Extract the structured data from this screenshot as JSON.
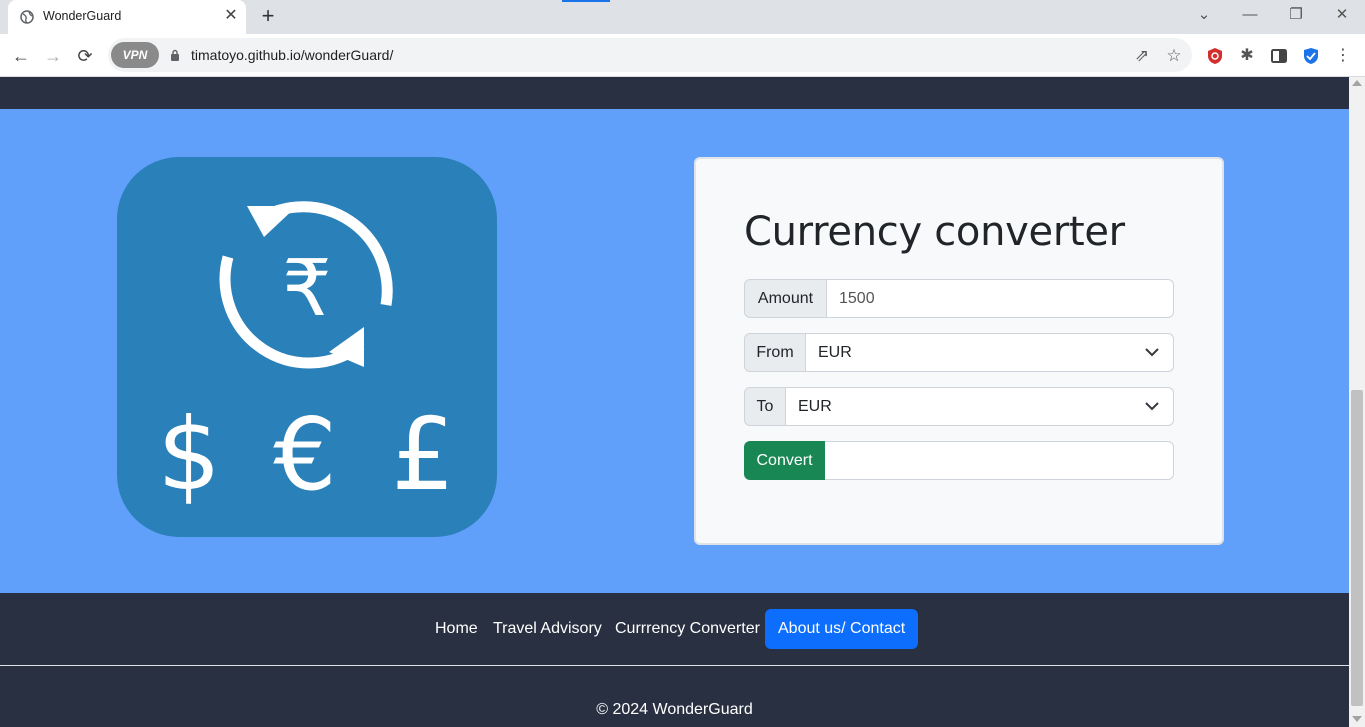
{
  "browser": {
    "tab_title": "WonderGuard",
    "tab_close_glyph": "✕",
    "new_tab_glyph": "+",
    "url": "timatoyo.github.io/wonderGuard/",
    "vpn_label": "VPN",
    "window_controls": {
      "collapse": "⌄",
      "minimize": "—",
      "restore": "❐",
      "close": "✕"
    },
    "nav": {
      "back": "←",
      "forward": "→",
      "reload": "⟳"
    },
    "omni_icons": {
      "share": "⇗",
      "bookmark": "☆"
    },
    "extensions": {
      "puzzle": "✱",
      "menu": "⋮"
    }
  },
  "converter": {
    "title": "Currency converter",
    "amount_label": "Amount",
    "amount_value": "1500",
    "from_label": "From",
    "from_value": "EUR",
    "to_label": "To",
    "to_value": "EUR",
    "convert_label": "Convert",
    "result_value": ""
  },
  "logo": {
    "icon": "currency-exchange-icon",
    "symbols": [
      "₹",
      "$",
      "€",
      "£"
    ],
    "bg_color": "#2a80b9"
  },
  "footer": {
    "nav": [
      "Home",
      "Travel Advisory",
      "Currrency Converter",
      "About us/ Contact"
    ],
    "active_item": "About us/ Contact",
    "copyright": "© 2024 WonderGuard"
  },
  "colors": {
    "hero_bg": "#60a0fb",
    "navbar_bg": "#283041",
    "convert_button": "#198754",
    "active_nav": "#0d6efd"
  }
}
